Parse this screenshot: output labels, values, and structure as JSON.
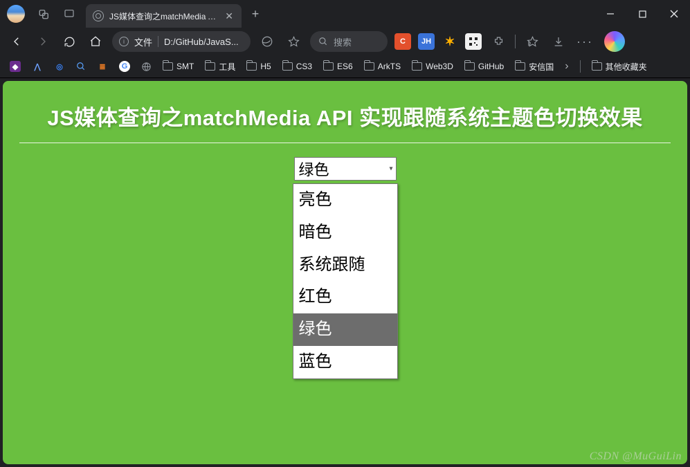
{
  "titlebar": {
    "tab_title": "JS媒体查询之matchMedia API 实现",
    "new_tab": "+",
    "minimize": "—",
    "maximize": "□",
    "close": "✕"
  },
  "toolbar": {
    "url_label": "文件",
    "url_path": "D:/GitHub/JavaS...",
    "search_placeholder": "搜索",
    "ext_c": "C",
    "ext_jh": "JH"
  },
  "bookmarks": {
    "items": [
      {
        "label": "SMT"
      },
      {
        "label": "工具"
      },
      {
        "label": "H5"
      },
      {
        "label": "CS3"
      },
      {
        "label": "ES6"
      },
      {
        "label": "ArkTS"
      },
      {
        "label": "Web3D"
      },
      {
        "label": "GitHub"
      },
      {
        "label": "安信国"
      }
    ],
    "overflow_label": "其他收藏夹",
    "chevron": "›"
  },
  "page": {
    "heading": "JS媒体查询之matchMedia API 实现跟随系统主题色切换效果",
    "select_value": "绿色",
    "options": [
      {
        "label": "亮色",
        "selected": false
      },
      {
        "label": "暗色",
        "selected": false
      },
      {
        "label": "系统跟随",
        "selected": false
      },
      {
        "label": "红色",
        "selected": false
      },
      {
        "label": "绿色",
        "selected": true
      },
      {
        "label": "蓝色",
        "selected": false
      }
    ]
  },
  "watermark": "CSDN @MuGuiLin"
}
